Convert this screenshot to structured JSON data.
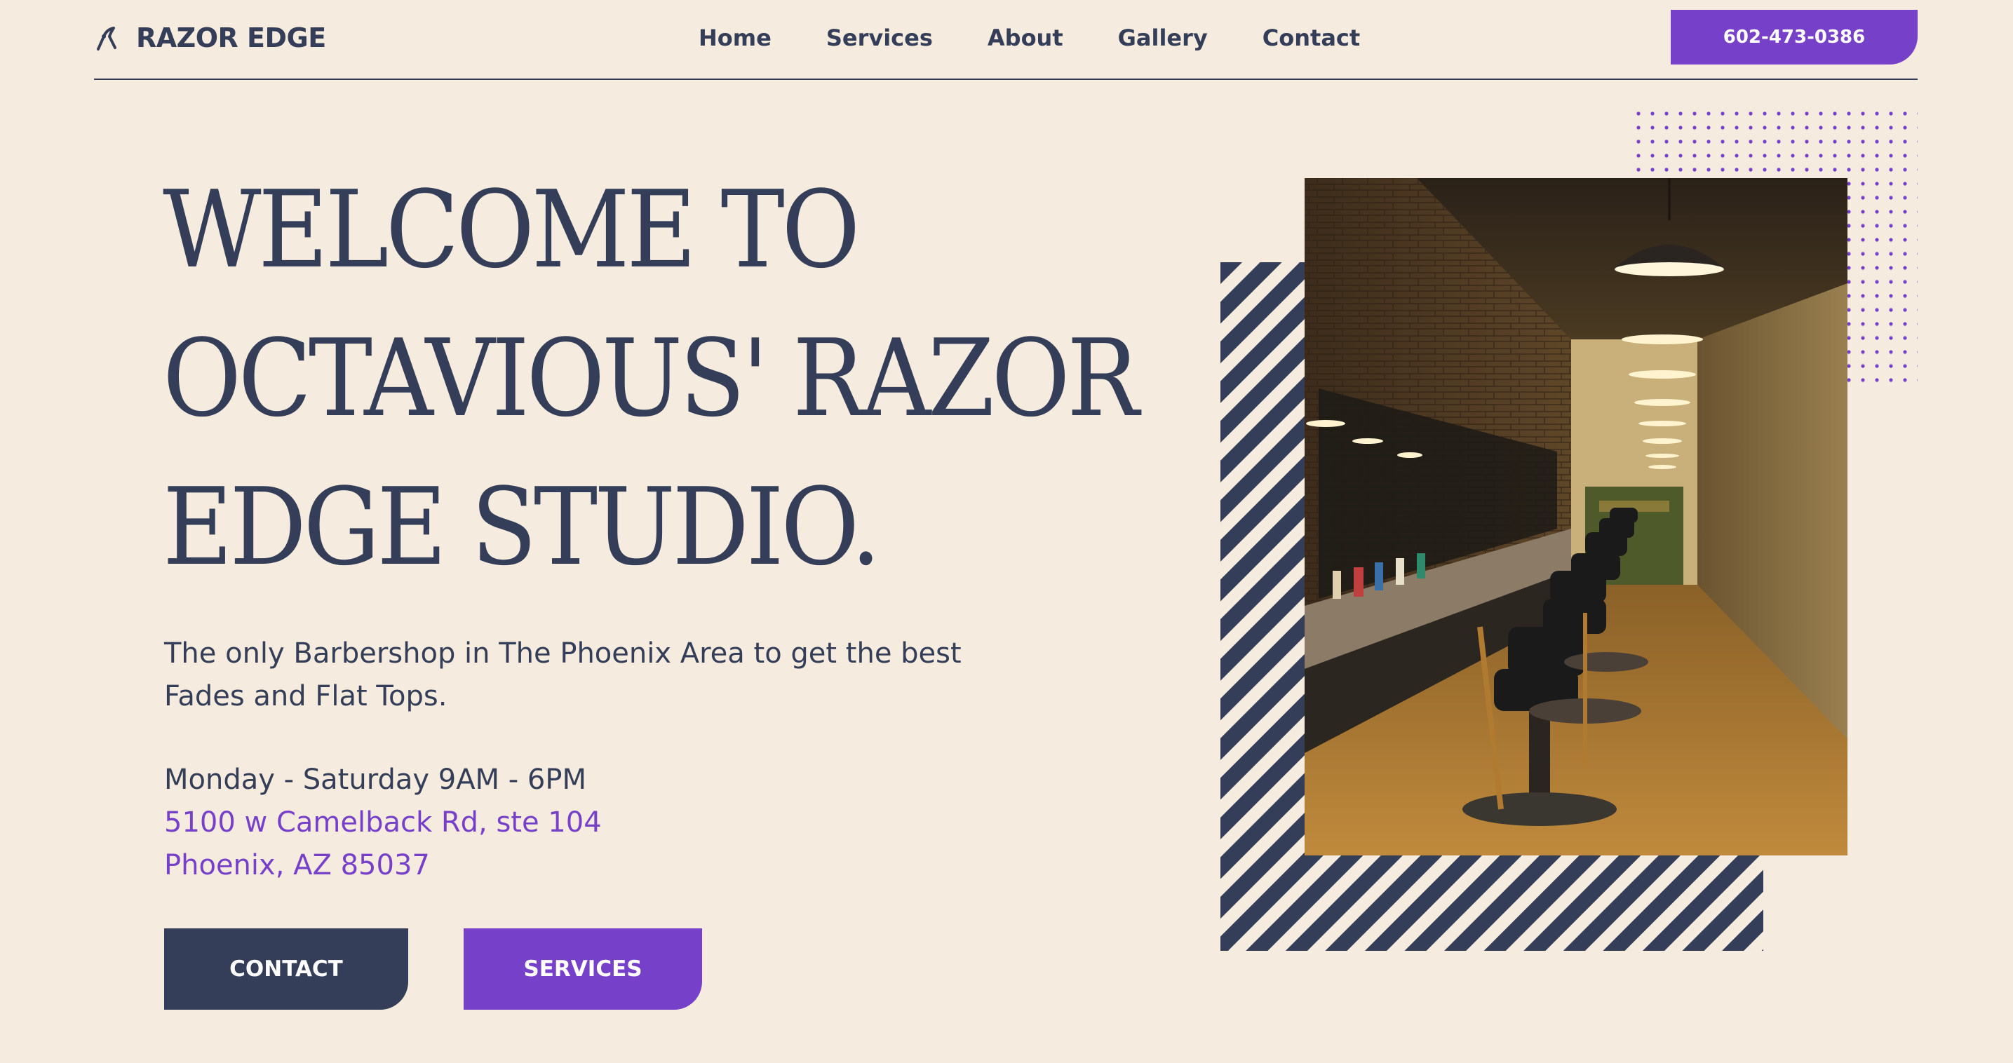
{
  "brand": {
    "name": "RAZOR EDGE",
    "icon": "razor-icon"
  },
  "nav": {
    "items": [
      "Home",
      "Services",
      "About",
      "Gallery",
      "Contact"
    ]
  },
  "header": {
    "phone": "602-473-0386"
  },
  "hero": {
    "title_lines": [
      "WELCOME TO",
      "OCTAVIOUS' RAZOR",
      "EDGE STUDIO."
    ],
    "tagline": "The only Barbershop in The Phoenix Area to get the best Fades and Flat Tops.",
    "hours": "Monday - Saturday 9AM - 6PM",
    "address_line1": "5100 w Camelback Rd, ste 104",
    "address_line2": "Phoenix, AZ 85037",
    "buttons": {
      "contact": "CONTACT",
      "services": "SERVICES"
    }
  },
  "colors": {
    "background": "#f5ebde",
    "navy": "#343e58",
    "purple": "#7740c9"
  }
}
